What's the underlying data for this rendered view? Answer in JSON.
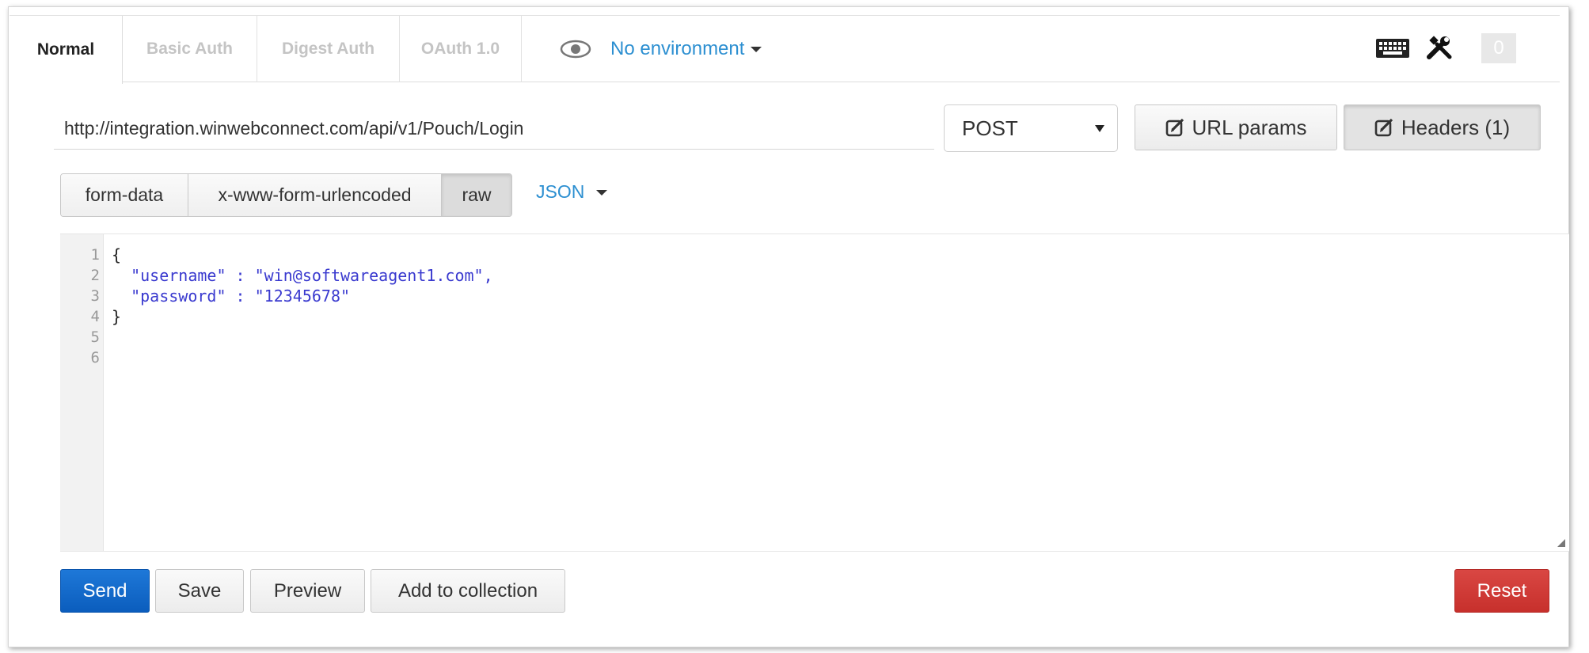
{
  "auth_tabs": [
    {
      "label": "Normal",
      "active": true
    },
    {
      "label": "Basic Auth",
      "active": false
    },
    {
      "label": "Digest Auth",
      "active": false
    },
    {
      "label": "OAuth 1.0",
      "active": false
    }
  ],
  "environment": {
    "label": "No environment",
    "icon": "eye-icon"
  },
  "toolbar_icons": {
    "keyboard": "keyboard-icon",
    "tools": "tools-icon",
    "counter": "0"
  },
  "request": {
    "url": "http://integration.winwebconnect.com/api/v1/Pouch/Login",
    "method": "POST",
    "url_params_label": "URL params",
    "headers_label": "Headers (1)"
  },
  "body_types": [
    {
      "label": "form-data",
      "active": false
    },
    {
      "label": "x-www-form-urlencoded",
      "active": false
    },
    {
      "label": "raw",
      "active": true
    }
  ],
  "body_language": "JSON",
  "editor": {
    "line_numbers": [
      "1",
      "2",
      "3",
      "4",
      "5",
      "6"
    ],
    "lines": [
      "{",
      "  \"username\" : \"win@softwareagent1.com\",",
      "  \"password\" : \"12345678\"",
      "}",
      "",
      ""
    ]
  },
  "actions": {
    "send": "Send",
    "save": "Save",
    "preview": "Preview",
    "add_to_collection": "Add to collection",
    "reset": "Reset"
  },
  "colors": {
    "link": "#2c8fd1",
    "send": "#0b5dbd",
    "reset": "#c7302c",
    "string": "#3a3acf"
  }
}
